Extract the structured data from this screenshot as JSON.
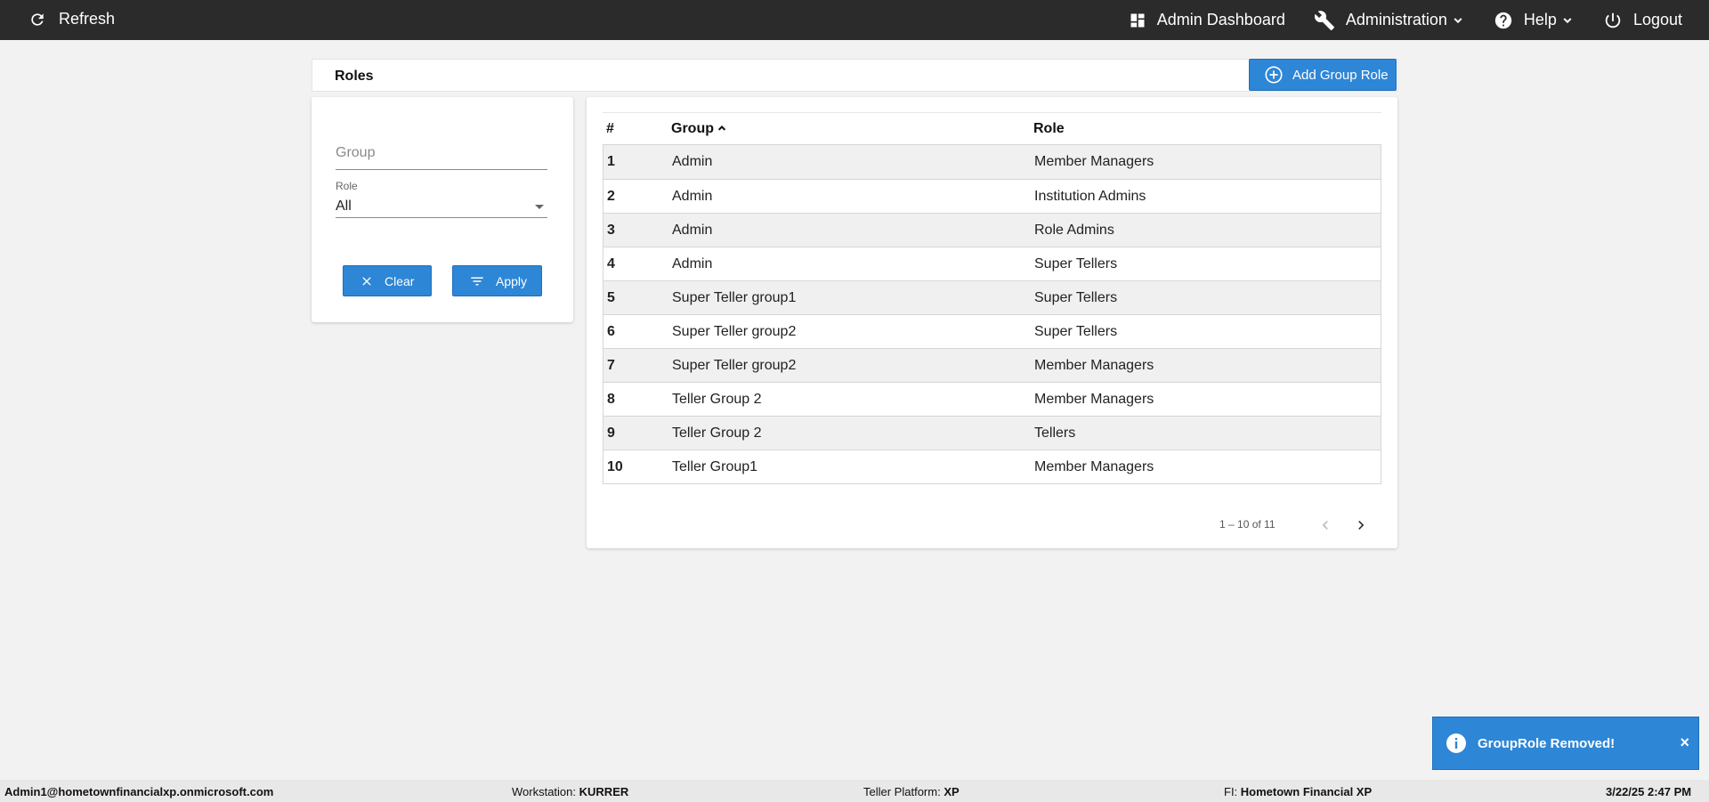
{
  "topbar": {
    "refresh_label": "Refresh",
    "admin_dashboard_label": "Admin Dashboard",
    "administration_label": "Administration",
    "help_label": "Help",
    "logout_label": "Logout"
  },
  "page": {
    "title": "Roles",
    "add_button_label": "Add Group Role"
  },
  "filters": {
    "group_placeholder": "Group",
    "group_value": "",
    "role_label": "Role",
    "role_value": "All",
    "clear_label": "Clear",
    "apply_label": "Apply"
  },
  "table": {
    "headers": {
      "num": "#",
      "group": "Group",
      "role": "Role"
    },
    "rows": [
      {
        "num": "1",
        "group": "Admin",
        "role": "Member Managers"
      },
      {
        "num": "2",
        "group": "Admin",
        "role": "Institution Admins"
      },
      {
        "num": "3",
        "group": "Admin",
        "role": "Role Admins"
      },
      {
        "num": "4",
        "group": "Admin",
        "role": "Super Tellers"
      },
      {
        "num": "5",
        "group": "Super Teller group1",
        "role": "Super Tellers"
      },
      {
        "num": "6",
        "group": "Super Teller group2",
        "role": "Super Tellers"
      },
      {
        "num": "7",
        "group": "Super Teller group2",
        "role": "Member Managers"
      },
      {
        "num": "8",
        "group": "Teller Group 2",
        "role": "Member Managers"
      },
      {
        "num": "9",
        "group": "Teller Group 2",
        "role": "Tellers"
      },
      {
        "num": "10",
        "group": "Teller Group1",
        "role": "Member Managers"
      }
    ],
    "pager_text": "1 – 10 of 11"
  },
  "toast": {
    "message": "GroupRole Removed!",
    "close": "×"
  },
  "statusbar": {
    "user": "Admin1@hometownfinancialxp.onmicrosoft.com",
    "workstation_label": "Workstation:",
    "workstation_value": "KURRER",
    "platform_label": "Teller Platform:",
    "platform_value": "XP",
    "fi_label": "FI:",
    "fi_value": "Hometown Financial XP",
    "datetime": "3/22/25 2:47 PM"
  },
  "colors": {
    "topbar": "#2b2b2b",
    "accent": "#2e86d6",
    "row_stripe": "#f0f0f0"
  }
}
